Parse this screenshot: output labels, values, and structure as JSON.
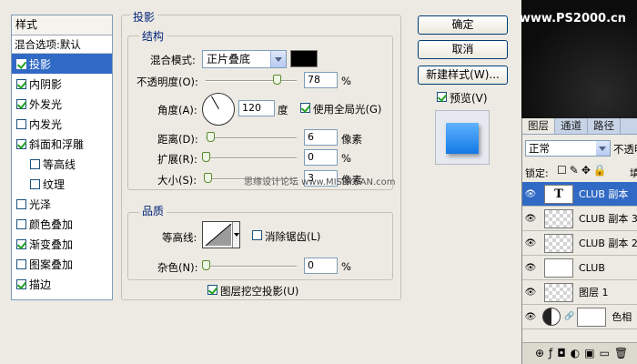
{
  "styles_panel": {
    "header": "样式",
    "blend_options": "混合选项:默认",
    "items": [
      {
        "label": "投影",
        "checked": true,
        "selected": true,
        "sub": false
      },
      {
        "label": "内阴影",
        "checked": true,
        "selected": false,
        "sub": false
      },
      {
        "label": "外发光",
        "checked": true,
        "selected": false,
        "sub": false
      },
      {
        "label": "内发光",
        "checked": false,
        "selected": false,
        "sub": false
      },
      {
        "label": "斜面和浮雕",
        "checked": true,
        "selected": false,
        "sub": false
      },
      {
        "label": "等高线",
        "checked": false,
        "selected": false,
        "sub": true
      },
      {
        "label": "纹理",
        "checked": false,
        "selected": false,
        "sub": true
      },
      {
        "label": "光泽",
        "checked": false,
        "selected": false,
        "sub": false
      },
      {
        "label": "颜色叠加",
        "checked": false,
        "selected": false,
        "sub": false
      },
      {
        "label": "渐变叠加",
        "checked": true,
        "selected": false,
        "sub": false
      },
      {
        "label": "图案叠加",
        "checked": false,
        "selected": false,
        "sub": false
      },
      {
        "label": "描边",
        "checked": true,
        "selected": false,
        "sub": false
      }
    ]
  },
  "drop_shadow": {
    "title": "投影",
    "structure": {
      "title": "结构",
      "blend_mode_label": "混合模式:",
      "blend_mode_value": "正片叠底",
      "shadow_color": "#000000",
      "opacity_label": "不透明度(O):",
      "opacity_value": "78",
      "opacity_percent": 78,
      "opacity_unit": "%",
      "angle_label": "角度(A):",
      "angle_value": "120",
      "angle_unit": "度",
      "global_light_label": "使用全局光(G)",
      "global_light_checked": true,
      "distance_label": "距离(D):",
      "distance_value": "6",
      "distance_unit": "像素",
      "spread_label": "扩展(R):",
      "spread_value": "0",
      "spread_unit": "%",
      "size_label": "大小(S):",
      "size_value": "3",
      "size_unit": "像素"
    },
    "quality": {
      "title": "品质",
      "contour_label": "等高线:",
      "anti_alias_label": "消除锯齿(L)",
      "anti_alias_checked": false,
      "noise_label": "杂色(N):",
      "noise_value": "0",
      "noise_unit": "%"
    },
    "knockout_label": "图层挖空投影(U)",
    "knockout_checked": true
  },
  "buttons": {
    "ok": "确定",
    "cancel": "取消",
    "new_style": "新建样式(W)...",
    "preview_label": "预览(V)",
    "preview_checked": true
  },
  "watermark": "www.PS2000.cn",
  "overlay_watermark": "思缘设计论坛 www.MISSYUAN.com",
  "layers_panel": {
    "tabs": [
      "图层",
      "通道",
      "路径"
    ],
    "blend_mode": "正常",
    "opacity_label": "不透明",
    "lock_label": "锁定:",
    "lock_icons": "☐✎✥🔒",
    "fill_label": "填",
    "layers": [
      {
        "name": "CLUB 副本",
        "type": "text",
        "selected": true
      },
      {
        "name": "CLUB 副本 3",
        "type": "raster",
        "selected": false
      },
      {
        "name": "CLUB 副本 2",
        "type": "raster",
        "selected": false
      },
      {
        "name": "CLUB",
        "type": "white",
        "selected": false
      },
      {
        "name": "图层 1",
        "type": "raster",
        "selected": false
      },
      {
        "name": "色相",
        "type": "adjustment",
        "selected": false
      }
    ],
    "bottom_icons": "⊕ƒ◘◐▣▭🗑"
  },
  "colors": {
    "accent": "#316ac5",
    "title": "#00217a",
    "preview_blue": "#1279e6"
  }
}
